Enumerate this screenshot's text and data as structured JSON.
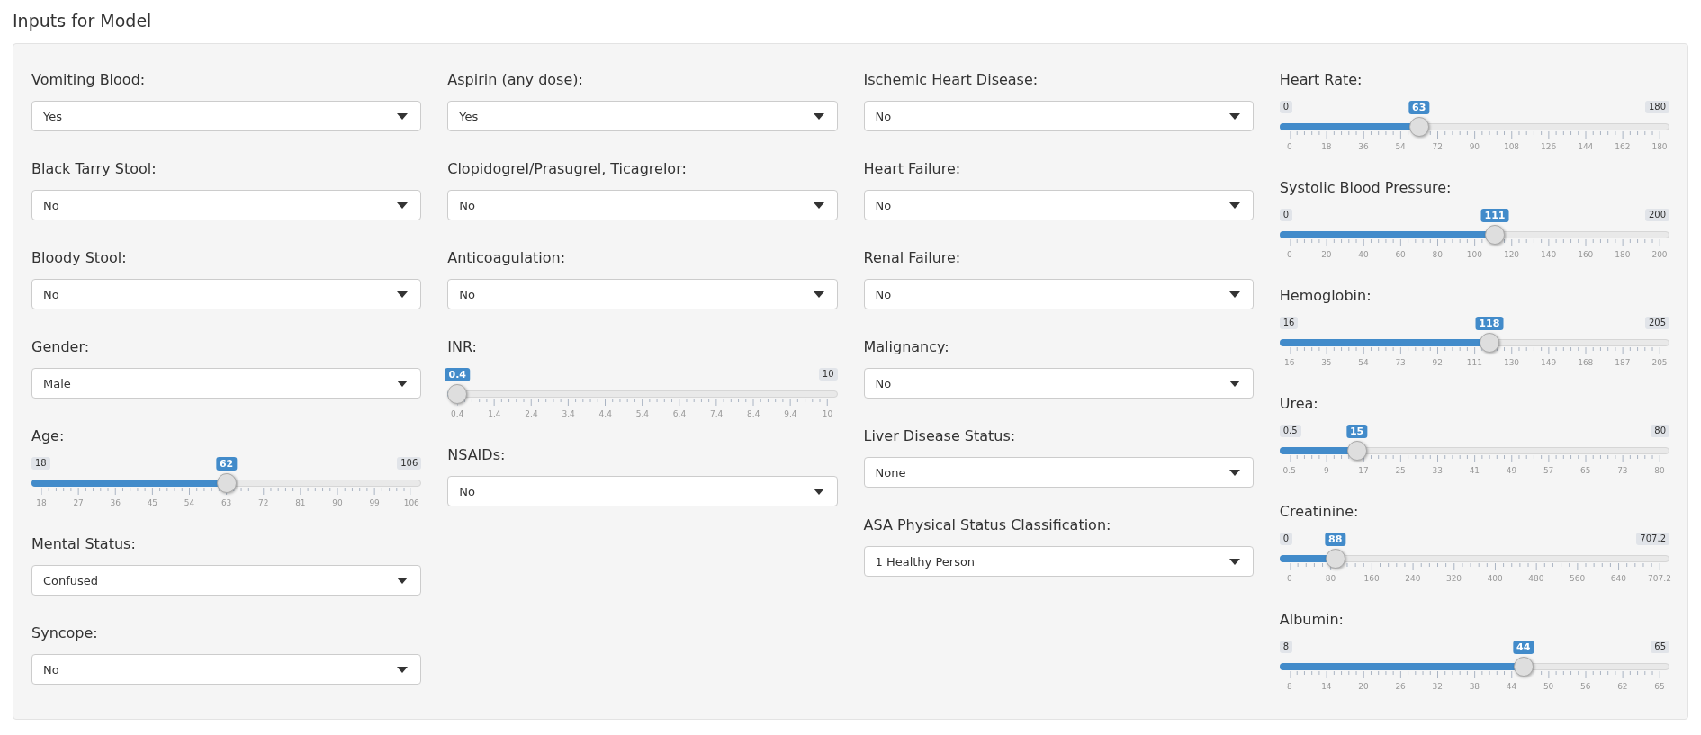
{
  "title": "Inputs for Model",
  "columns": [
    [
      {
        "kind": "select",
        "label": "Vomiting Blood:",
        "value": "Yes"
      },
      {
        "kind": "select",
        "label": "Black Tarry Stool:",
        "value": "No"
      },
      {
        "kind": "select",
        "label": "Bloody Stool:",
        "value": "No"
      },
      {
        "kind": "select",
        "label": "Gender:",
        "value": "Male"
      },
      {
        "kind": "slider",
        "label": "Age:",
        "min": "18",
        "max": "106",
        "value": "62",
        "level": 0.5,
        "ticks": [
          "18",
          "27",
          "36",
          "45",
          "54",
          "63",
          "72",
          "81",
          "90",
          "99",
          "106"
        ]
      },
      {
        "kind": "select",
        "label": "Mental Status:",
        "value": "Confused"
      },
      {
        "kind": "select",
        "label": "Syncope:",
        "value": "No"
      }
    ],
    [
      {
        "kind": "select",
        "label": "Aspirin (any dose):",
        "value": "Yes"
      },
      {
        "kind": "select",
        "label": "Clopidogrel/Prasugrel, Ticagrelor:",
        "value": "No"
      },
      {
        "kind": "select",
        "label": "Anticoagulation:",
        "value": "No"
      },
      {
        "kind": "slider",
        "label": "INR:",
        "max": "10",
        "value": "0.4",
        "level": 0,
        "ticks": [
          "0.4",
          "1.4",
          "2.4",
          "3.4",
          "4.4",
          "5.4",
          "6.4",
          "7.4",
          "8.4",
          "9.4",
          "10"
        ]
      },
      {
        "kind": "select",
        "label": "NSAIDs:",
        "value": "No"
      }
    ],
    [
      {
        "kind": "select",
        "label": "Ischemic Heart Disease:",
        "value": "No"
      },
      {
        "kind": "select",
        "label": "Heart Failure:",
        "value": "No"
      },
      {
        "kind": "select",
        "label": "Renal Failure:",
        "value": "No"
      },
      {
        "kind": "select",
        "label": "Malignancy:",
        "value": "No"
      },
      {
        "kind": "select",
        "label": "Liver Disease Status:",
        "value": "None"
      },
      {
        "kind": "select",
        "label": "ASA Physical Status Classification:",
        "value": "1 Healthy Person"
      }
    ],
    [
      {
        "kind": "slider",
        "label": "Heart Rate:",
        "min": "0",
        "max": "180",
        "value": "63",
        "level": 0.35,
        "ticks": [
          "0",
          "18",
          "36",
          "54",
          "72",
          "90",
          "108",
          "126",
          "144",
          "162",
          "180"
        ]
      },
      {
        "kind": "slider",
        "label": "Systolic Blood Pressure:",
        "min": "0",
        "max": "200",
        "value": "111",
        "level": 0.555,
        "ticks": [
          "0",
          "20",
          "40",
          "60",
          "80",
          "100",
          "120",
          "140",
          "160",
          "180",
          "200"
        ]
      },
      {
        "kind": "slider",
        "label": "Hemoglobin:",
        "min": "16",
        "max": "205",
        "value": "118",
        "level": 0.54,
        "ticks": [
          "16",
          "35",
          "54",
          "73",
          "92",
          "111",
          "130",
          "149",
          "168",
          "187",
          "205"
        ]
      },
      {
        "kind": "slider",
        "label": "Urea:",
        "min": "0.5",
        "max": "80",
        "value": "15",
        "level": 0.182,
        "ticks": [
          "0.5",
          "9",
          "17",
          "25",
          "33",
          "41",
          "49",
          "57",
          "65",
          "73",
          "80"
        ]
      },
      {
        "kind": "slider",
        "label": "Creatinine:",
        "min": "0",
        "max": "707.2",
        "value": "88",
        "level": 0.124,
        "ticks": [
          "0",
          "80",
          "160",
          "240",
          "320",
          "400",
          "480",
          "560",
          "640",
          "707.2"
        ]
      },
      {
        "kind": "slider",
        "label": "Albumin:",
        "min": "8",
        "max": "65",
        "value": "44",
        "level": 0.632,
        "ticks": [
          "8",
          "14",
          "20",
          "26",
          "32",
          "38",
          "44",
          "50",
          "56",
          "62",
          "65"
        ]
      }
    ]
  ]
}
